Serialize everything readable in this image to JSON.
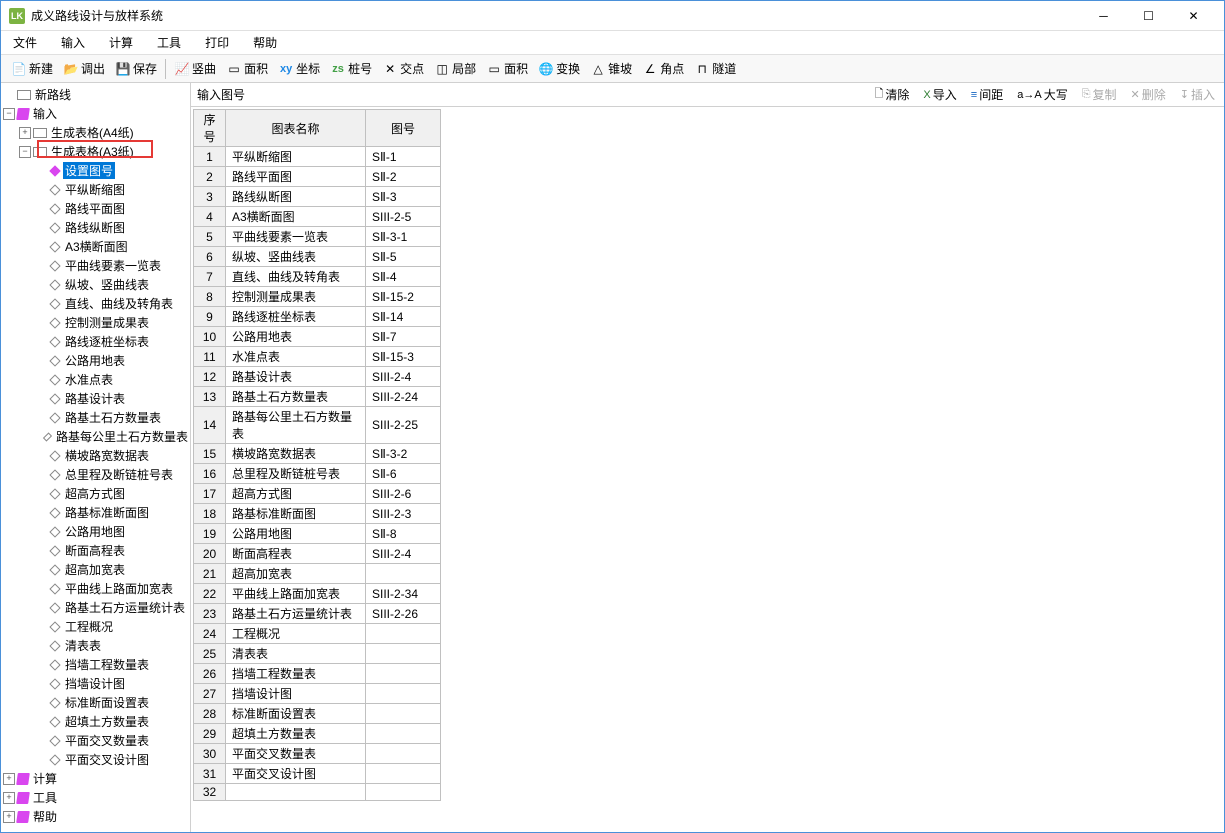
{
  "window": {
    "title": "成义路线设计与放样系统"
  },
  "menu": [
    "文件",
    "输入",
    "计算",
    "工具",
    "打印",
    "帮助"
  ],
  "toolbar": [
    {
      "icon": "📄",
      "label": "新建"
    },
    {
      "icon": "📂",
      "label": "调出"
    },
    {
      "icon": "💾",
      "label": "保存"
    },
    {
      "sep": true
    },
    {
      "icon": "📈",
      "label": "竖曲"
    },
    {
      "icon": "▭",
      "label": "面积"
    },
    {
      "icon": "xy",
      "label": "坐标",
      "color": "#1e88e5"
    },
    {
      "icon": "zs",
      "label": "桩号",
      "color": "#43a047"
    },
    {
      "icon": "✕",
      "label": "交点"
    },
    {
      "icon": "◫",
      "label": "局部"
    },
    {
      "icon": "▭",
      "label": "面积"
    },
    {
      "icon": "🌐",
      "label": "变换"
    },
    {
      "icon": "△",
      "label": "锥坡"
    },
    {
      "icon": "∠",
      "label": "角点"
    },
    {
      "icon": "⊓",
      "label": "隧道"
    }
  ],
  "main_header": "输入图号",
  "main_tools": [
    {
      "icon": "🗋",
      "label": "清除",
      "disabled": false
    },
    {
      "icon": "X",
      "label": "导入",
      "disabled": false,
      "color": "#2e7d32"
    },
    {
      "icon": "≡",
      "label": "间距",
      "disabled": false,
      "color": "#1565c0"
    },
    {
      "icon": "a→A",
      "label": "大写",
      "disabled": false
    },
    {
      "icon": "⎘",
      "label": "复制",
      "disabled": true
    },
    {
      "icon": "✕",
      "label": "删除",
      "disabled": true
    },
    {
      "icon": "↧",
      "label": "插入",
      "disabled": true
    }
  ],
  "columns": [
    "序 号",
    "图表名称",
    "图号"
  ],
  "rows": [
    {
      "n": "1",
      "name": "平纵断缩图",
      "code": "SⅡ-1"
    },
    {
      "n": "2",
      "name": "路线平面图",
      "code": "SⅡ-2"
    },
    {
      "n": "3",
      "name": "路线纵断图",
      "code": "SⅡ-3"
    },
    {
      "n": "4",
      "name": "A3横断面图",
      "code": "SIII-2-5"
    },
    {
      "n": "5",
      "name": "平曲线要素一览表",
      "code": "SⅡ-3-1"
    },
    {
      "n": "6",
      "name": "纵坡、竖曲线表",
      "code": "SⅡ-5"
    },
    {
      "n": "7",
      "name": "直线、曲线及转角表",
      "code": "SⅡ-4"
    },
    {
      "n": "8",
      "name": "控制测量成果表",
      "code": "SⅡ-15-2"
    },
    {
      "n": "9",
      "name": "路线逐桩坐标表",
      "code": "SⅡ-14"
    },
    {
      "n": "10",
      "name": "公路用地表",
      "code": "SⅡ-7"
    },
    {
      "n": "11",
      "name": "水准点表",
      "code": "SⅡ-15-3"
    },
    {
      "n": "12",
      "name": "路基设计表",
      "code": "SIII-2-4"
    },
    {
      "n": "13",
      "name": "路基土石方数量表",
      "code": "SIII-2-24"
    },
    {
      "n": "14",
      "name": "路基每公里土石方数量表",
      "code": "SIII-2-25"
    },
    {
      "n": "15",
      "name": "横坡路宽数据表",
      "code": "SⅡ-3-2"
    },
    {
      "n": "16",
      "name": "总里程及断链桩号表",
      "code": "SⅡ-6"
    },
    {
      "n": "17",
      "name": "超高方式图",
      "code": "SIII-2-6"
    },
    {
      "n": "18",
      "name": "路基标准断面图",
      "code": "SIII-2-3"
    },
    {
      "n": "19",
      "name": "公路用地图",
      "code": "SⅡ-8"
    },
    {
      "n": "20",
      "name": "断面高程表",
      "code": "SIII-2-4"
    },
    {
      "n": "21",
      "name": "超高加宽表",
      "code": ""
    },
    {
      "n": "22",
      "name": "平曲线上路面加宽表",
      "code": "SIII-2-34"
    },
    {
      "n": "23",
      "name": "路基土石方运量统计表",
      "code": "SIII-2-26"
    },
    {
      "n": "24",
      "name": "工程概况",
      "code": ""
    },
    {
      "n": "25",
      "name": "清表表",
      "code": ""
    },
    {
      "n": "26",
      "name": "挡墙工程数量表",
      "code": ""
    },
    {
      "n": "27",
      "name": "挡墙设计图",
      "code": ""
    },
    {
      "n": "28",
      "name": "标准断面设置表",
      "code": ""
    },
    {
      "n": "29",
      "name": "超填土方数量表",
      "code": ""
    },
    {
      "n": "30",
      "name": "平面交叉数量表",
      "code": ""
    },
    {
      "n": "31",
      "name": "平面交叉设计图",
      "code": ""
    },
    {
      "n": "32",
      "name": "",
      "code": ""
    }
  ],
  "tree": {
    "root": "新路线",
    "input": "输入",
    "a4": "生成表格(A4纸)",
    "a3": "生成表格(A3纸)",
    "selected": "设置图号",
    "a3_children": [
      "平纵断缩图",
      "路线平面图",
      "路线纵断图",
      "A3横断面图",
      "平曲线要素一览表",
      "纵坡、竖曲线表",
      "直线、曲线及转角表",
      "控制测量成果表",
      "路线逐桩坐标表",
      "公路用地表",
      "水准点表",
      "路基设计表",
      "路基土石方数量表",
      "路基每公里土石方数量表",
      "横坡路宽数据表",
      "总里程及断链桩号表",
      "超高方式图",
      "路基标准断面图",
      "公路用地图",
      "断面高程表",
      "超高加宽表",
      "平曲线上路面加宽表",
      "路基土石方运量统计表",
      "工程概况",
      "清表表",
      "挡墙工程数量表",
      "挡墙设计图",
      "标准断面设置表",
      "超填土方数量表",
      "平面交叉数量表",
      "平面交叉设计图"
    ],
    "calc": "计算",
    "tools": "工具",
    "help": "帮助"
  }
}
